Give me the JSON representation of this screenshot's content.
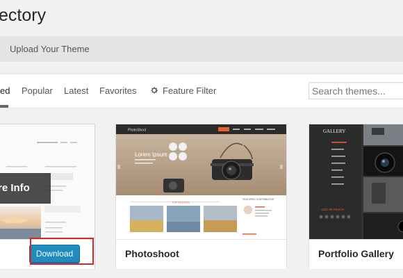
{
  "page": {
    "title": "ectory"
  },
  "toolbar": {
    "upload_label": "Upload Your Theme"
  },
  "filters": {
    "tabs": [
      {
        "label": "ed"
      },
      {
        "label": "Popular"
      },
      {
        "label": "Latest"
      },
      {
        "label": "Favorites"
      }
    ],
    "feature_filter_label": "Feature Filter",
    "search_placeholder": "Search themes..."
  },
  "themes": [
    {
      "name": "",
      "overlay_label": "re Info",
      "download_label": "Download"
    },
    {
      "name": "Photoshoot",
      "preview": {
        "site_title": "PhotoShoot",
        "hero_text": "Lorem Ipsum",
        "section_label": "TOP PHOTOS",
        "sidebar_heading": "FEATURED CONTRIBUTOR"
      }
    },
    {
      "name": "Portfolio Gallery",
      "preview": {
        "logo": "GALLERY",
        "cta": "GET IN TOUCH"
      }
    }
  ],
  "colors": {
    "primary_button": "#1e8cbe",
    "highlight_box": "#e02424",
    "accent_orange": "#e8602c"
  }
}
